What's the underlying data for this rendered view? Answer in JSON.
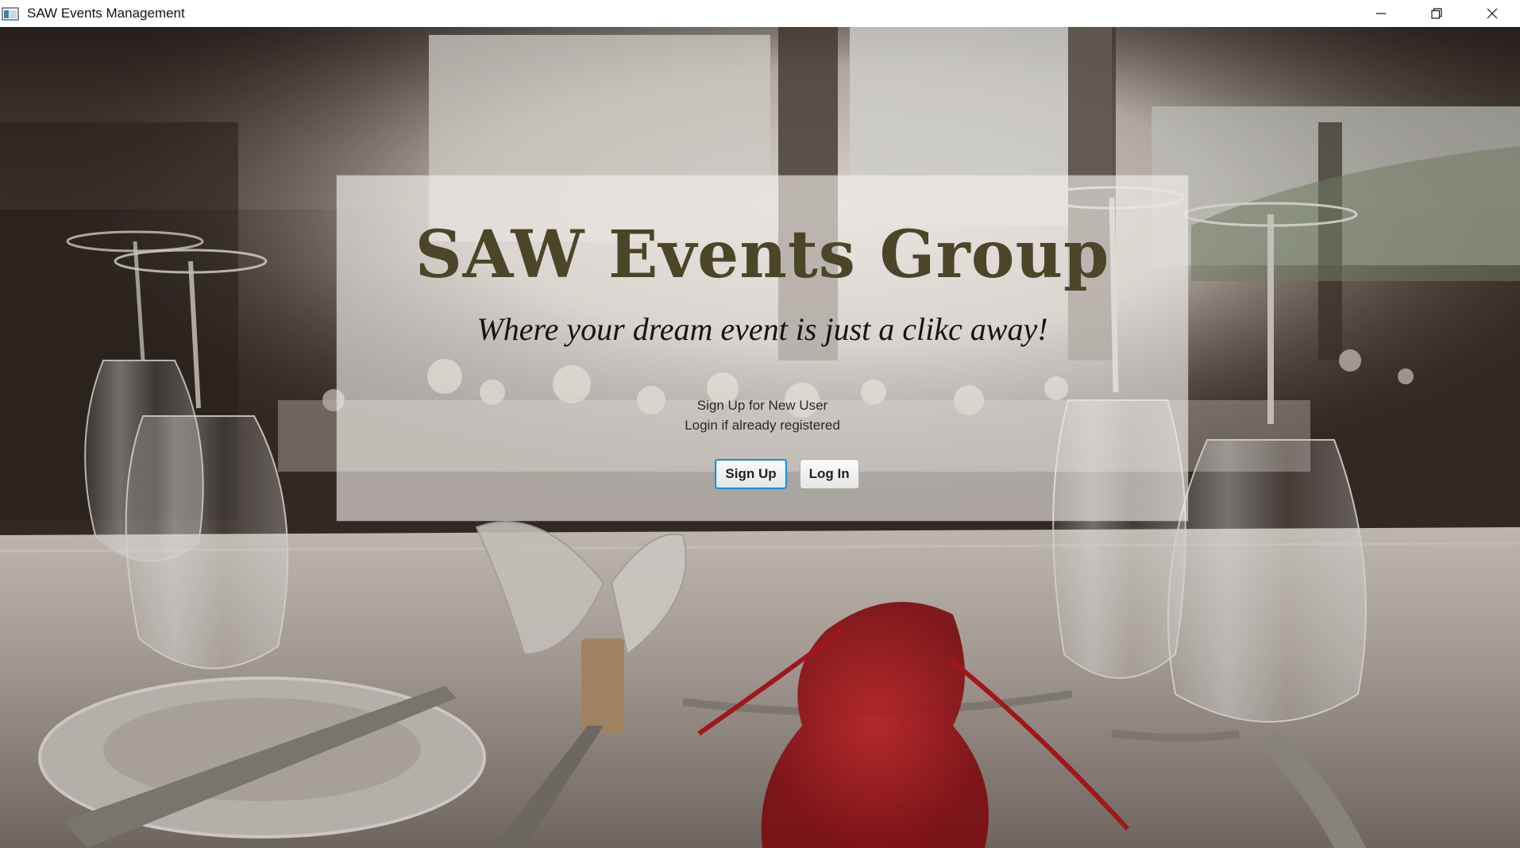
{
  "window": {
    "title": "SAW Events Management",
    "icon": "java-app-icon",
    "controls": {
      "minimize": "minimize-icon",
      "restore": "restore-icon",
      "close": "close-icon"
    }
  },
  "panel": {
    "title": "SAW Events Group",
    "tagline": "Where your dream event is just a clikc away!",
    "instruction_line1": "Sign Up for New User",
    "instruction_line2": "Login if already registered",
    "signup_label": "Sign Up",
    "login_label": "Log In"
  },
  "colors": {
    "title_text": "#4b4628",
    "button_focus_border": "#1e8fd8",
    "panel_overlay": "rgba(245,240,238,0.62)"
  }
}
